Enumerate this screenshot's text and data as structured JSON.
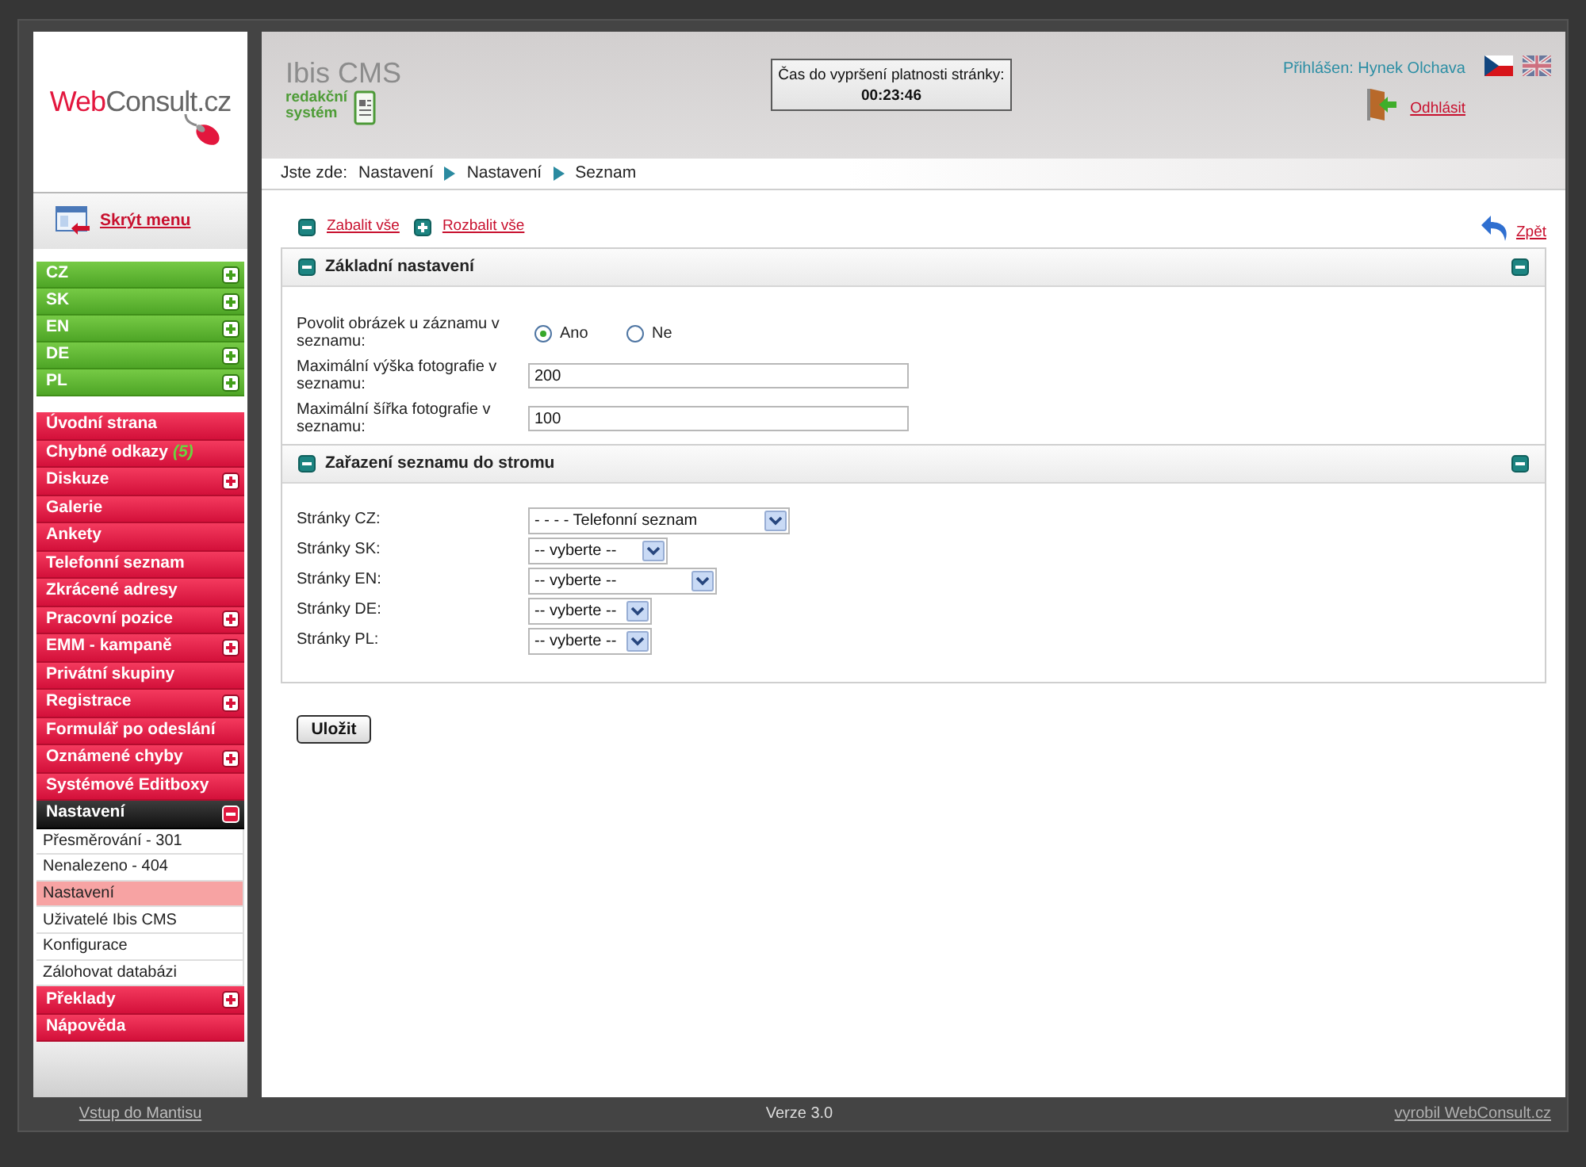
{
  "sidebar": {
    "logo": {
      "primary": "Web",
      "secondary": "Consult.cz"
    },
    "hide_menu": "Skrýt menu",
    "language_items": [
      {
        "label": "CZ",
        "expanded": false
      },
      {
        "label": "SK",
        "expanded": false
      },
      {
        "label": "EN",
        "expanded": false
      },
      {
        "label": "DE",
        "expanded": false
      },
      {
        "label": "PL",
        "expanded": false
      }
    ],
    "menu_items": [
      {
        "kind": "link",
        "label": "Úvodní strana"
      },
      {
        "kind": "link",
        "label": "Chybné odkazy",
        "count": "(5)"
      },
      {
        "kind": "group",
        "label": "Diskuze",
        "expanded": false
      },
      {
        "kind": "link",
        "label": "Galerie"
      },
      {
        "kind": "link",
        "label": "Ankety"
      },
      {
        "kind": "link",
        "label": "Telefonní seznam"
      },
      {
        "kind": "link",
        "label": "Zkrácené adresy"
      },
      {
        "kind": "group",
        "label": "Pracovní pozice",
        "expanded": false
      },
      {
        "kind": "group",
        "label": "EMM - kampaně",
        "expanded": false
      },
      {
        "kind": "link",
        "label": "Privátní skupiny"
      },
      {
        "kind": "group",
        "label": "Registrace",
        "expanded": false
      },
      {
        "kind": "link",
        "label": "Formulář po odeslání"
      },
      {
        "kind": "group",
        "label": "Oznámené chyby",
        "expanded": false
      },
      {
        "kind": "link",
        "label": "Systémové Editboxy"
      },
      {
        "kind": "group",
        "label": "Nastavení",
        "expanded": true,
        "children": [
          {
            "label": "Přesměrování - 301",
            "selected": false
          },
          {
            "label": "Nenalezeno - 404",
            "selected": false
          },
          {
            "label": "Nastavení",
            "selected": true
          },
          {
            "label": "Uživatelé Ibis CMS",
            "selected": false
          },
          {
            "label": "Konfigurace",
            "selected": false
          },
          {
            "label": "Zálohovat databázi",
            "selected": false
          }
        ]
      },
      {
        "kind": "group",
        "label": "Překlady",
        "expanded": false
      },
      {
        "kind": "link",
        "label": "Nápověda"
      }
    ]
  },
  "header": {
    "logo": {
      "title": "Ibis CMS",
      "subtitle": "redakční systém"
    },
    "session": {
      "label": "Čas do vypršení platnosti stránky:",
      "time": "00:23:46"
    },
    "user": "Přihlášen: Hynek Olchava",
    "languages": [
      {
        "kind": "czech",
        "selected": true
      },
      {
        "kind": "british",
        "selected": false
      }
    ],
    "logout": "Odhlásit"
  },
  "breadcrumb": {
    "label": "Jste zde:",
    "items": [
      "Nastavení",
      "Nastavení",
      "Seznam"
    ]
  },
  "toolbar": {
    "actions": [
      {
        "kind": "collapse",
        "label": "Zabalit vše"
      },
      {
        "kind": "expand",
        "label": "Rozbalit vše"
      }
    ],
    "back": "Zpět"
  },
  "sections": [
    {
      "title": "Základní nastavení",
      "expanded": true,
      "fields": [
        {
          "kind": "radio",
          "label": "Povolit obrázek u záznamu v seznamu:",
          "options": [
            {
              "label": "Ano",
              "selected": true
            },
            {
              "label": "Ne",
              "selected": false
            }
          ]
        },
        {
          "kind": "text",
          "label": "Maximální výška fotografie v seznamu:",
          "value": "200"
        },
        {
          "kind": "text",
          "label": "Maximální šířka fotografie v seznamu:",
          "value": "100"
        }
      ]
    },
    {
      "title": "Zařazení seznamu do stromu",
      "expanded": true,
      "fields": [
        {
          "kind": "select",
          "label": "Stránky CZ:",
          "value": "- - - - Telefonní seznam"
        },
        {
          "kind": "select",
          "label": "Stránky SK:",
          "value": "-- vyberte --"
        },
        {
          "kind": "select",
          "label": "Stránky EN:",
          "value": "-- vyberte --"
        },
        {
          "kind": "select",
          "label": "Stránky DE:",
          "value": "-- vyberte --"
        },
        {
          "kind": "select",
          "label": "Stránky PL:",
          "value": "-- vyberte --"
        }
      ]
    }
  ],
  "save_button": "Uložit",
  "footer": {
    "left": "Vstup do Mantisu",
    "center": "Verze 3.0",
    "right": "vyrobil WebConsult.cz"
  }
}
